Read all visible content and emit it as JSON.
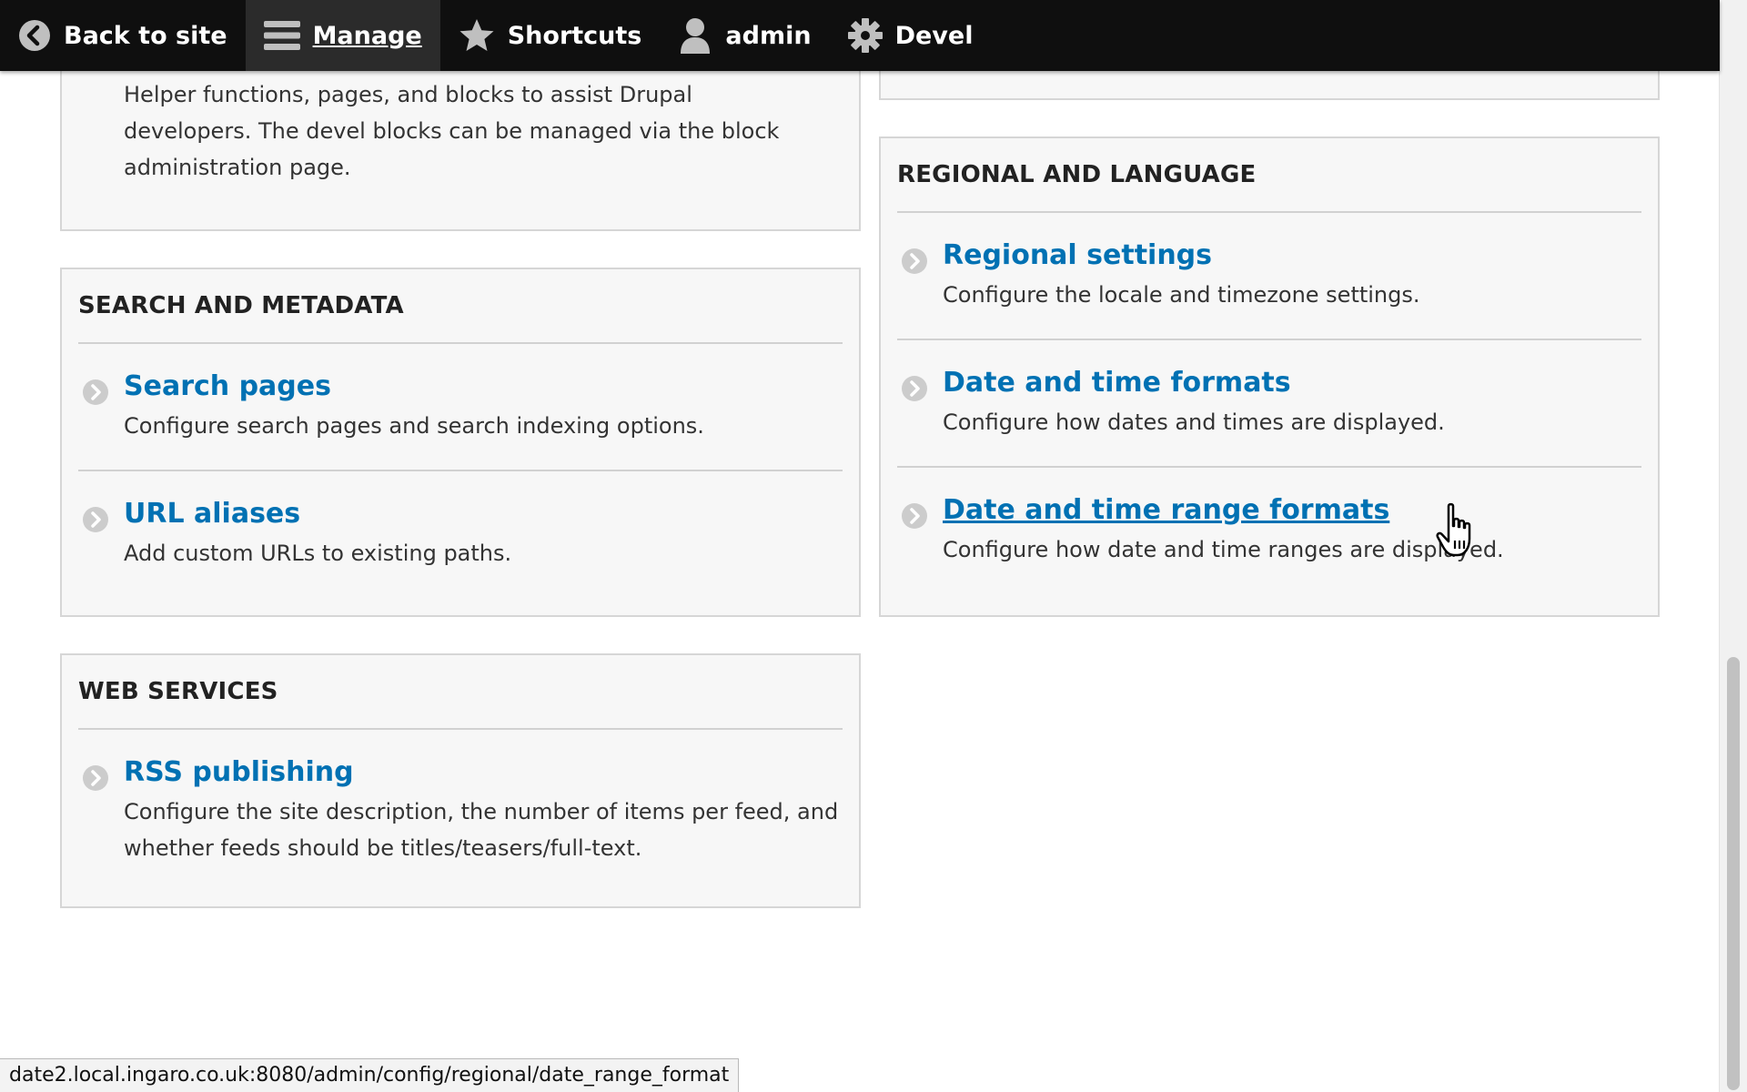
{
  "toolbar": {
    "back": "Back to site",
    "manage": "Manage",
    "shortcuts": "Shortcuts",
    "user": "admin",
    "devel": "Devel"
  },
  "devel_panel": {
    "description": "Helper functions, pages, and blocks to assist Drupal developers. The devel blocks can be managed via the block administration page."
  },
  "search_panel": {
    "title": "SEARCH AND METADATA",
    "items": [
      {
        "label": "Search pages",
        "description": "Configure search pages and search indexing options."
      },
      {
        "label": "URL aliases",
        "description": "Add custom URLs to existing paths."
      }
    ]
  },
  "web_services_panel": {
    "title": "WEB SERVICES",
    "items": [
      {
        "label": "RSS publishing",
        "description": "Configure the site description, the number of items per feed, and whether feeds should be titles/teasers/full-text."
      }
    ]
  },
  "regional_panel": {
    "title": "REGIONAL AND LANGUAGE",
    "items": [
      {
        "label": "Regional settings",
        "description": "Configure the locale and timezone settings."
      },
      {
        "label": "Date and time formats",
        "description": "Configure how dates and times are displayed."
      },
      {
        "label": "Date and time range formats",
        "description": "Configure how date and time ranges are displayed."
      }
    ]
  },
  "status_url": "date2.local.ingaro.co.uk:8080/admin/config/regional/date_range_format",
  "colors": {
    "toolbar_bg": "#0f0f0f",
    "link": "#0071b3",
    "panel_bg": "#f7f7f7",
    "panel_border": "#d6d6d6"
  }
}
